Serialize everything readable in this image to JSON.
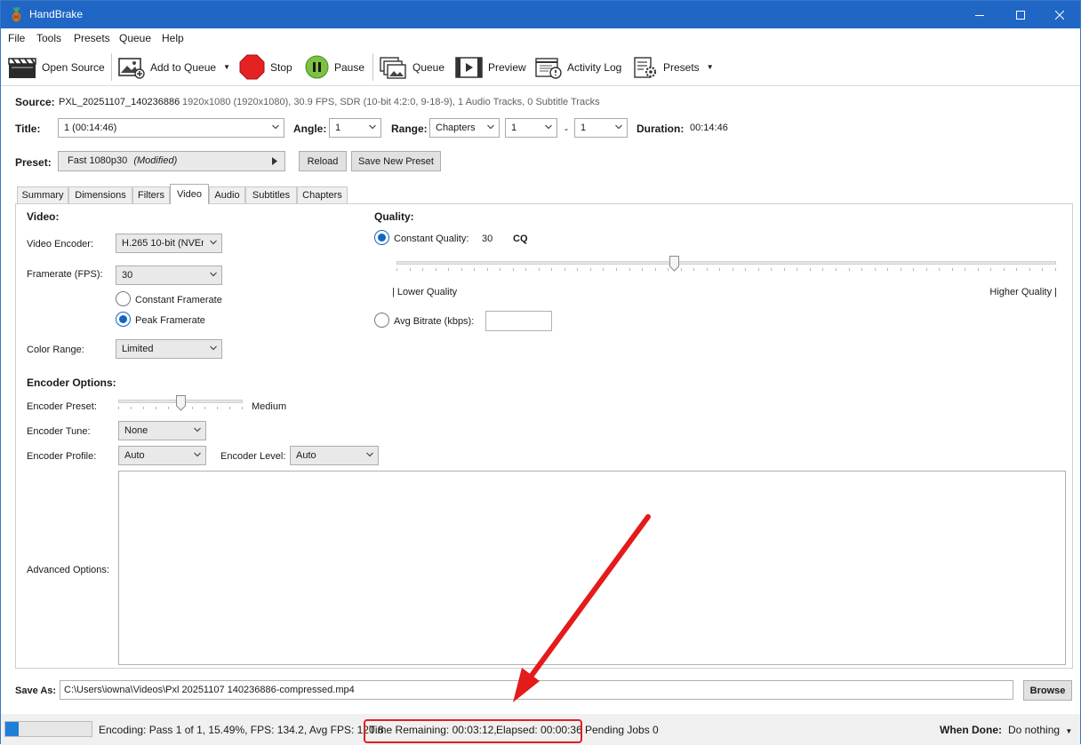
{
  "window": {
    "title": "HandBrake"
  },
  "menu": [
    "File",
    "Tools",
    "Presets",
    "Queue",
    "Help"
  ],
  "toolbar": {
    "open_source": "Open Source",
    "add_to_queue": "Add to Queue",
    "stop": "Stop",
    "pause": "Pause",
    "queue": "Queue",
    "preview": "Preview",
    "activity_log": "Activity Log",
    "presets": "Presets"
  },
  "source": {
    "label": "Source:",
    "name": "PXL_20251107_140236886",
    "info": "1920x1080 (1920x1080), 30.9 FPS, SDR (10-bit 4:2:0, 9-18-9), 1 Audio Tracks, 0 Subtitle Tracks"
  },
  "title_row": {
    "title_label": "Title:",
    "title_value": "1  (00:14:46)",
    "angle_label": "Angle:",
    "angle_value": "1",
    "range_label": "Range:",
    "range_mode": "Chapters",
    "range_start": "1",
    "range_dash": "-",
    "range_end": "1",
    "duration_label": "Duration:",
    "duration_value": "00:14:46"
  },
  "preset_row": {
    "label": "Preset:",
    "name": "Fast 1080p30",
    "modified": "(Modified)",
    "reload": "Reload",
    "save_new": "Save New Preset"
  },
  "tabs": [
    "Summary",
    "Dimensions",
    "Filters",
    "Video",
    "Audio",
    "Subtitles",
    "Chapters"
  ],
  "active_tab": "Video",
  "video": {
    "section": "Video:",
    "encoder_label": "Video Encoder:",
    "encoder_value": "H.265 10-bit (NVEnc)",
    "framerate_label": "Framerate (FPS):",
    "framerate_value": "30",
    "constant_framerate": "Constant Framerate",
    "peak_framerate": "Peak Framerate",
    "color_range_label": "Color Range:",
    "color_range_value": "Limited"
  },
  "quality": {
    "section": "Quality:",
    "constant_quality_label": "Constant Quality:",
    "constant_quality_value": "30",
    "unit": "CQ",
    "slider_fraction": 0.42,
    "lower": "| Lower Quality",
    "higher": "Higher Quality |",
    "avg_bitrate_label": "Avg Bitrate (kbps):",
    "avg_bitrate_value": ""
  },
  "encoder_options": {
    "section": "Encoder Options:",
    "preset_label": "Encoder Preset:",
    "preset_value": "Medium",
    "preset_slider_fraction": 0.5,
    "tune_label": "Encoder Tune:",
    "tune_value": "None",
    "profile_label": "Encoder Profile:",
    "profile_value": "Auto",
    "level_label": "Encoder Level:",
    "level_value": "Auto",
    "advanced_label": "Advanced Options:"
  },
  "save_as": {
    "label": "Save As:",
    "path": "C:\\Users\\iowna\\Videos\\Pxl 20251107 140236886-compressed.mp4",
    "browse": "Browse"
  },
  "status": {
    "progress_percent": 15.49,
    "encoding": "Encoding: Pass 1 of 1,  15.49%, FPS: 134.2,  Avg FPS: 120.8",
    "time_remaining": "Time Remaining: 00:03:12,",
    "elapsed": "Elapsed: 00:00:36",
    "pending": "Pending Jobs 0",
    "when_done_label": "When Done:",
    "when_done_value": "Do nothing"
  },
  "colors": {
    "titlebar": "#1f66c5",
    "accent": "#1565c0",
    "annotation": "#e02020"
  }
}
